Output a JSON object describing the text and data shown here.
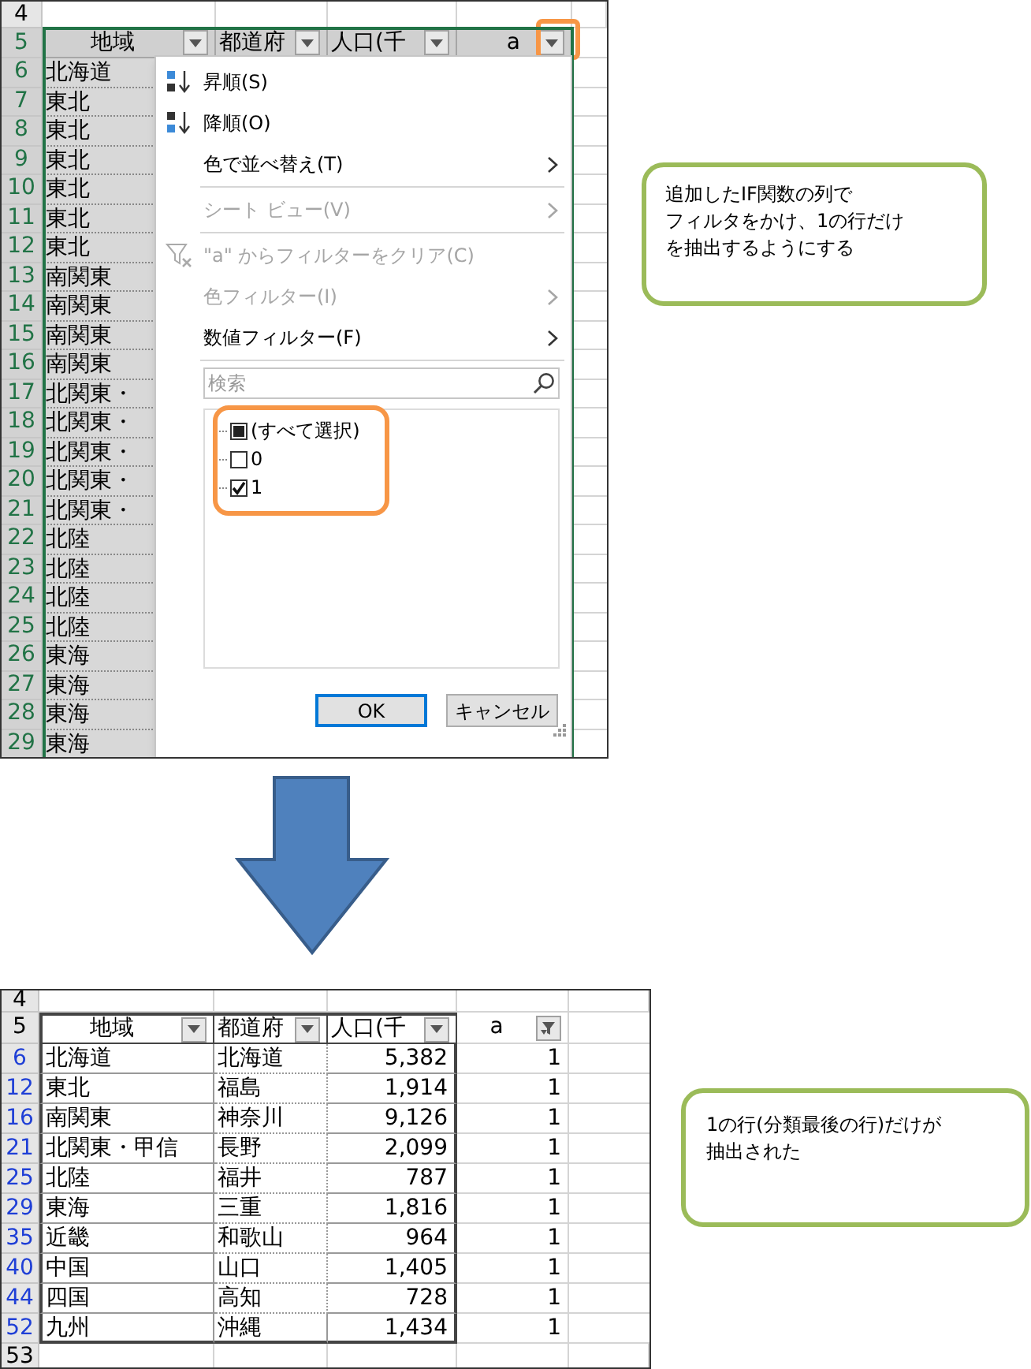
{
  "top_sheet": {
    "top_row": {
      "number": "4",
      "selected": false
    },
    "header_row": {
      "number": "5",
      "selected": true,
      "columns": [
        {
          "label": "地域",
          "highlighted": false
        },
        {
          "label": "都道府",
          "highlighted": false
        },
        {
          "label": "人口(千",
          "highlighted": false
        },
        {
          "label": "a",
          "highlighted": true
        }
      ]
    },
    "rows": [
      {
        "number": "6",
        "selected": true,
        "region": "北海道"
      },
      {
        "number": "7",
        "selected": true,
        "region": "東北"
      },
      {
        "number": "8",
        "selected": true,
        "region": "東北"
      },
      {
        "number": "9",
        "selected": true,
        "region": "東北"
      },
      {
        "number": "10",
        "selected": true,
        "region": "東北"
      },
      {
        "number": "11",
        "selected": true,
        "region": "東北"
      },
      {
        "number": "12",
        "selected": true,
        "region": "東北"
      },
      {
        "number": "13",
        "selected": true,
        "region": "南関東"
      },
      {
        "number": "14",
        "selected": true,
        "region": "南関東"
      },
      {
        "number": "15",
        "selected": true,
        "region": "南関東"
      },
      {
        "number": "16",
        "selected": true,
        "region": "南関東"
      },
      {
        "number": "17",
        "selected": true,
        "region": "北関東・"
      },
      {
        "number": "18",
        "selected": true,
        "region": "北関東・"
      },
      {
        "number": "19",
        "selected": true,
        "region": "北関東・"
      },
      {
        "number": "20",
        "selected": true,
        "region": "北関東・"
      },
      {
        "number": "21",
        "selected": true,
        "region": "北関東・"
      },
      {
        "number": "22",
        "selected": true,
        "region": "北陸"
      },
      {
        "number": "23",
        "selected": true,
        "region": "北陸"
      },
      {
        "number": "24",
        "selected": true,
        "region": "北陸"
      },
      {
        "number": "25",
        "selected": true,
        "region": "北陸"
      },
      {
        "number": "26",
        "selected": true,
        "region": "東海"
      },
      {
        "number": "27",
        "selected": true,
        "region": "東海"
      },
      {
        "number": "28",
        "selected": true,
        "region": "東海"
      },
      {
        "number": "29",
        "selected": true,
        "region": "東海"
      }
    ],
    "filter_menu": {
      "items": [
        {
          "kind": "ascending",
          "label": "昇順(S)",
          "disabled": false,
          "has_submenu": false
        },
        {
          "kind": "descending",
          "label": "降順(O)",
          "disabled": false,
          "has_submenu": false
        },
        {
          "kind": "command",
          "label": "色で並べ替え(T)",
          "disabled": false,
          "has_submenu": true
        },
        {
          "kind": "separator"
        },
        {
          "kind": "command",
          "label": "シート ビュー(V)",
          "disabled": true,
          "has_submenu": true
        },
        {
          "kind": "separator"
        },
        {
          "kind": "clear",
          "label": "\"a\" からフィルターをクリア(C)",
          "disabled": true,
          "has_submenu": false
        },
        {
          "kind": "command",
          "label": "色フィルター(I)",
          "disabled": true,
          "has_submenu": true
        },
        {
          "kind": "command",
          "label": "数値フィルター(F)",
          "disabled": false,
          "has_submenu": true
        },
        {
          "kind": "separator"
        }
      ],
      "search": {
        "placeholder": "検索"
      },
      "values": {
        "highlighted": true,
        "items": [
          {
            "label": "(すべて選択)",
            "checked": false,
            "mixed": true
          },
          {
            "label": "0",
            "checked": false,
            "mixed": false
          },
          {
            "label": "1",
            "checked": true,
            "mixed": false
          }
        ]
      },
      "buttons": [
        {
          "label": "OK",
          "default": true
        },
        {
          "label": "キャンセル",
          "default": false
        }
      ]
    }
  },
  "callouts": [
    {
      "lines": [
        "追加したIF関数の列で",
        "フィルタをかけ、1の行だけ",
        "を抽出するようにする"
      ]
    },
    {
      "lines": [
        "1の行(分類最後の行)だけが",
        "抽出された"
      ]
    }
  ],
  "bottom_sheet": {
    "top_row": {
      "number": "4",
      "filtered": false
    },
    "header_row": {
      "number": "5",
      "filtered": false,
      "columns": [
        {
          "label": "地域",
          "filter_applied": false
        },
        {
          "label": "都道府",
          "filter_applied": false
        },
        {
          "label": "人口(千",
          "filter_applied": false
        },
        {
          "label": "a",
          "filter_applied": true
        }
      ]
    },
    "rows": [
      {
        "number": "6",
        "filtered": true,
        "region": "北海道",
        "prefecture": "北海道",
        "population": "5,382",
        "a": "1"
      },
      {
        "number": "12",
        "filtered": true,
        "region": "東北",
        "prefecture": "福島",
        "population": "1,914",
        "a": "1"
      },
      {
        "number": "16",
        "filtered": true,
        "region": "南関東",
        "prefecture": "神奈川",
        "population": "9,126",
        "a": "1"
      },
      {
        "number": "21",
        "filtered": true,
        "region": "北関東・甲信",
        "prefecture": "長野",
        "population": "2,099",
        "a": "1"
      },
      {
        "number": "25",
        "filtered": true,
        "region": "北陸",
        "prefecture": "福井",
        "population": "787",
        "a": "1"
      },
      {
        "number": "29",
        "filtered": true,
        "region": "東海",
        "prefecture": "三重",
        "population": "1,816",
        "a": "1"
      },
      {
        "number": "35",
        "filtered": true,
        "region": "近畿",
        "prefecture": "和歌山",
        "population": "964",
        "a": "1"
      },
      {
        "number": "40",
        "filtered": true,
        "region": "中国",
        "prefecture": "山口",
        "population": "1,405",
        "a": "1"
      },
      {
        "number": "44",
        "filtered": true,
        "region": "四国",
        "prefecture": "高知",
        "population": "728",
        "a": "1"
      },
      {
        "number": "52",
        "filtered": true,
        "region": "九州",
        "prefecture": "沖縄",
        "population": "1,434",
        "a": "1"
      }
    ],
    "bottom_row": {
      "number": "53",
      "filtered": false
    }
  }
}
